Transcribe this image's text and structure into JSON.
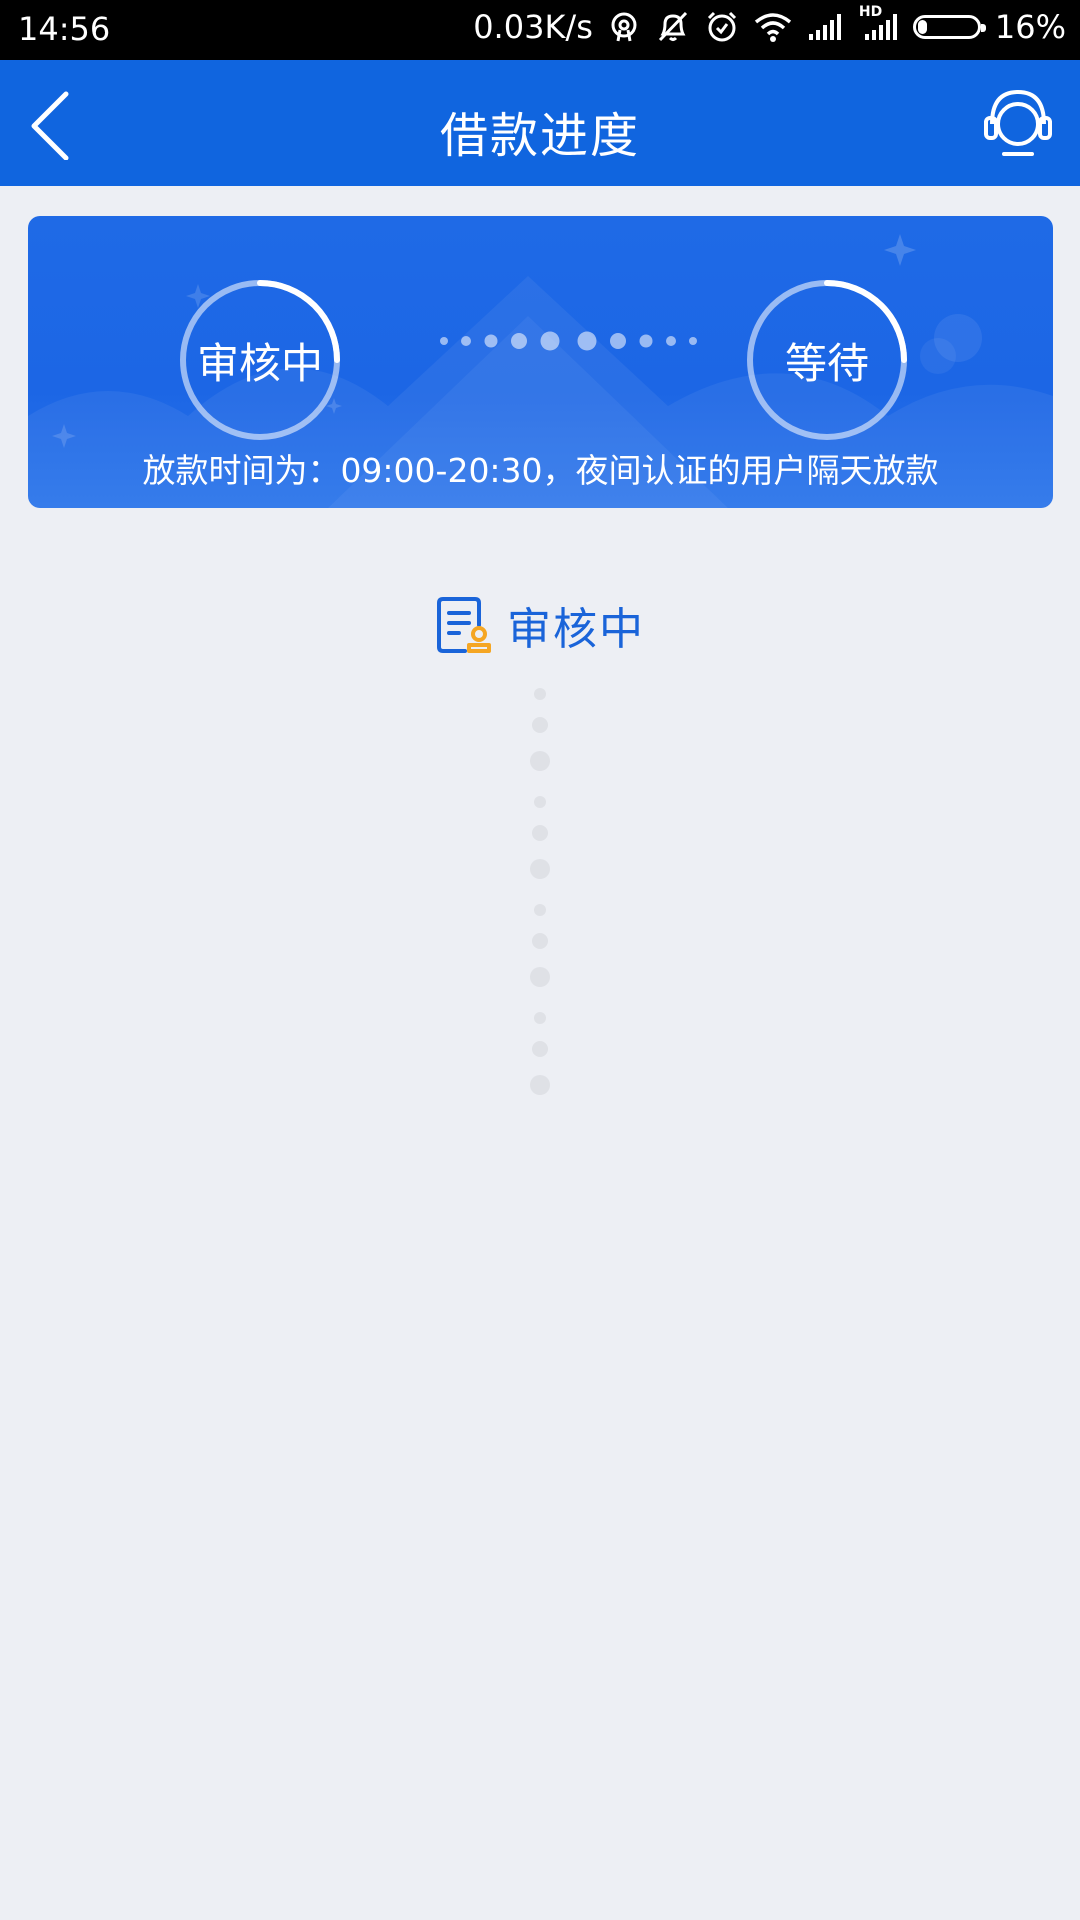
{
  "status_bar": {
    "time": "14:56",
    "network_speed": "0.03K/s",
    "battery_percent": "16%",
    "battery_level": 0.16,
    "icons": [
      "hotspot-icon",
      "mute-icon",
      "alarm-icon",
      "wifi-icon",
      "signal-icon",
      "hd-signal-icon",
      "battery-icon"
    ],
    "hd_label": "HD"
  },
  "navbar": {
    "title": "借款进度",
    "back_icon": "chevron-left-icon",
    "support_icon": "headset-icon",
    "color": "#1065df"
  },
  "progress_card": {
    "step1_label": "审核中",
    "step2_label": "等待",
    "note": "放款时间为：09:00-20:30，夜间认证的用户隔天放款",
    "color": "#1c66e5"
  },
  "status": {
    "label": "审核中",
    "icon": "review-document-icon",
    "label_color": "#1a64d9",
    "accent_color": "#f5a623"
  }
}
